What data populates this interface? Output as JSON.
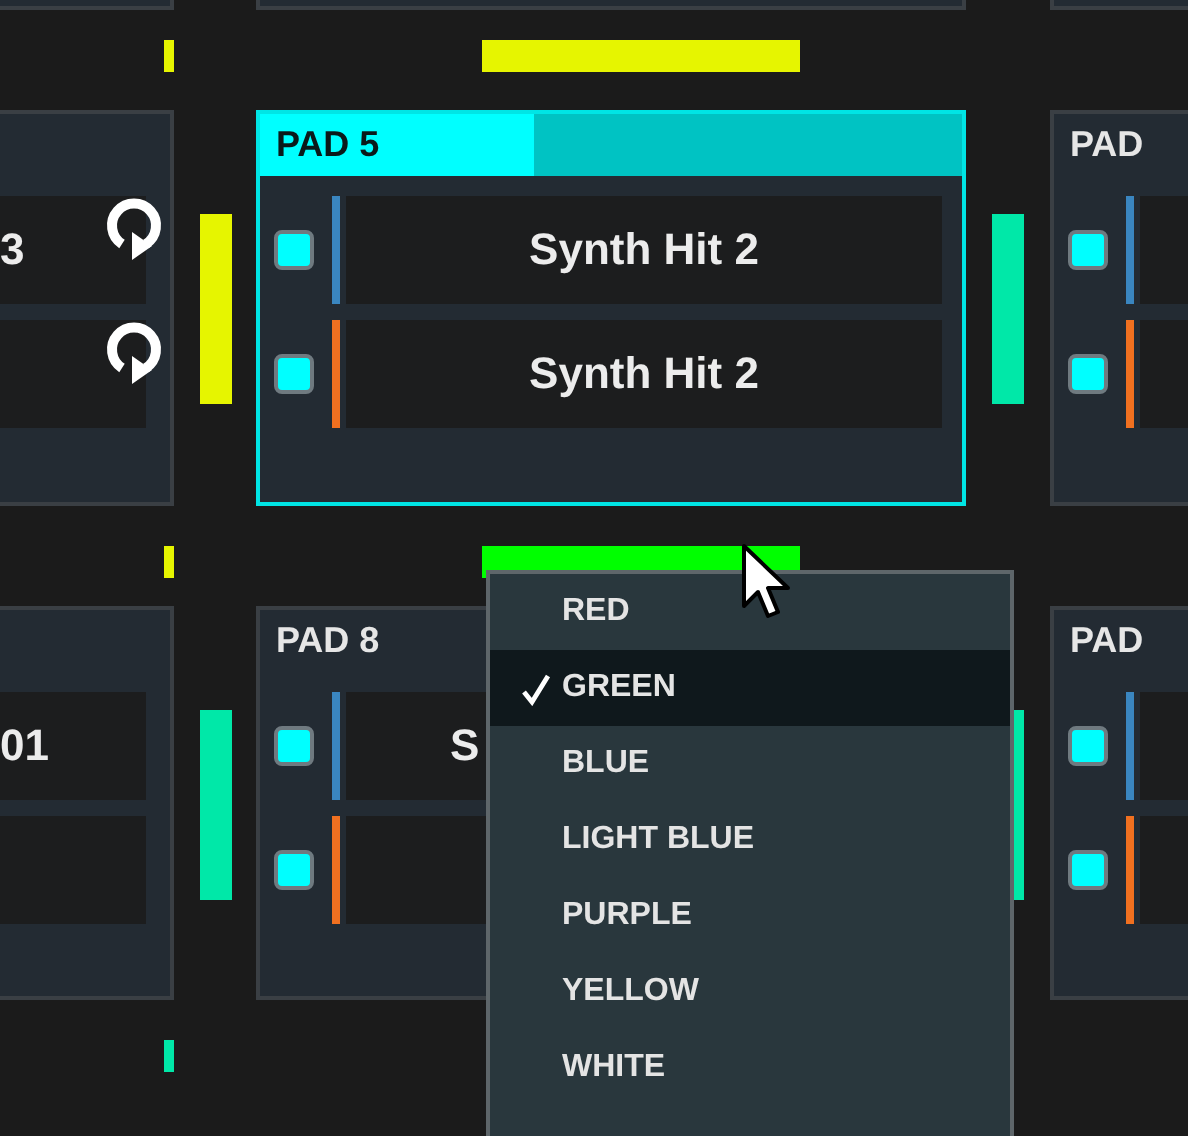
{
  "rows": [
    {
      "kind": "strip",
      "stubs": true,
      "bars": [
        {
          "color": "#e6f500"
        },
        {
          "color": "#e6f500"
        }
      ]
    },
    {
      "kind": "pads",
      "side_bars": [
        {
          "color": "#e6f500"
        },
        {
          "color": "#00e8a8"
        }
      ],
      "pads": [
        {
          "kind": "cut_left",
          "selected": false,
          "samples": [
            {
              "kind": "slot",
              "name": "3",
              "cut": true,
              "loop": true
            },
            {
              "kind": "slot",
              "loop": true
            }
          ]
        },
        {
          "kind": "full",
          "title": "PAD 5",
          "selected": true,
          "level": 0.39,
          "samples": [
            {
              "kind": "slot",
              "name": "Synth Hit 2",
              "checked": true,
              "color": "#3a86c0"
            },
            {
              "kind": "slot",
              "name": "Synth Hit 2",
              "checked": true,
              "color": "#f07020"
            }
          ]
        },
        {
          "kind": "cut_right",
          "title": "PAD",
          "selected": false,
          "samples": [
            {
              "kind": "slot",
              "checked": true,
              "color": "#3a86c0"
            },
            {
              "kind": "slot",
              "checked": true,
              "color": "#f07020"
            }
          ]
        }
      ]
    },
    {
      "kind": "strip",
      "bars": [
        {
          "color": "#e6f500"
        },
        {
          "color": "#00ff00"
        }
      ]
    },
    {
      "kind": "pads",
      "side_bars": [
        {
          "color": "#00e8a8"
        },
        {
          "color": "#00e8a8"
        }
      ],
      "pads": [
        {
          "kind": "cut_left",
          "selected": false,
          "samples": [
            {
              "kind": "slot",
              "name": "01",
              "cut": true
            },
            {
              "kind": "slot"
            }
          ]
        },
        {
          "kind": "full",
          "title": "PAD 8",
          "selected": false,
          "samples": [
            {
              "kind": "slot",
              "name": "S",
              "cut": true,
              "checked": true,
              "color": "#3a86c0"
            },
            {
              "kind": "slot",
              "checked": true,
              "color": "#f07020"
            }
          ]
        },
        {
          "kind": "cut_right",
          "title": "PAD",
          "selected": false,
          "samples": [
            {
              "kind": "slot",
              "checked": true,
              "color": "#3a86c0"
            },
            {
              "kind": "slot",
              "checked": true,
              "color": "#f07020"
            }
          ]
        }
      ]
    },
    {
      "kind": "strip",
      "bars": [
        {
          "color": "#00e8a8"
        }
      ]
    }
  ],
  "color_menu": {
    "items": [
      {
        "label": "RED",
        "selected": false
      },
      {
        "label": "GREEN",
        "selected": true
      },
      {
        "label": "BLUE",
        "selected": false
      },
      {
        "label": "LIGHT BLUE",
        "selected": false
      },
      {
        "label": "PURPLE",
        "selected": false
      },
      {
        "label": "YELLOW",
        "selected": false
      },
      {
        "label": "WHITE",
        "selected": false
      }
    ]
  }
}
